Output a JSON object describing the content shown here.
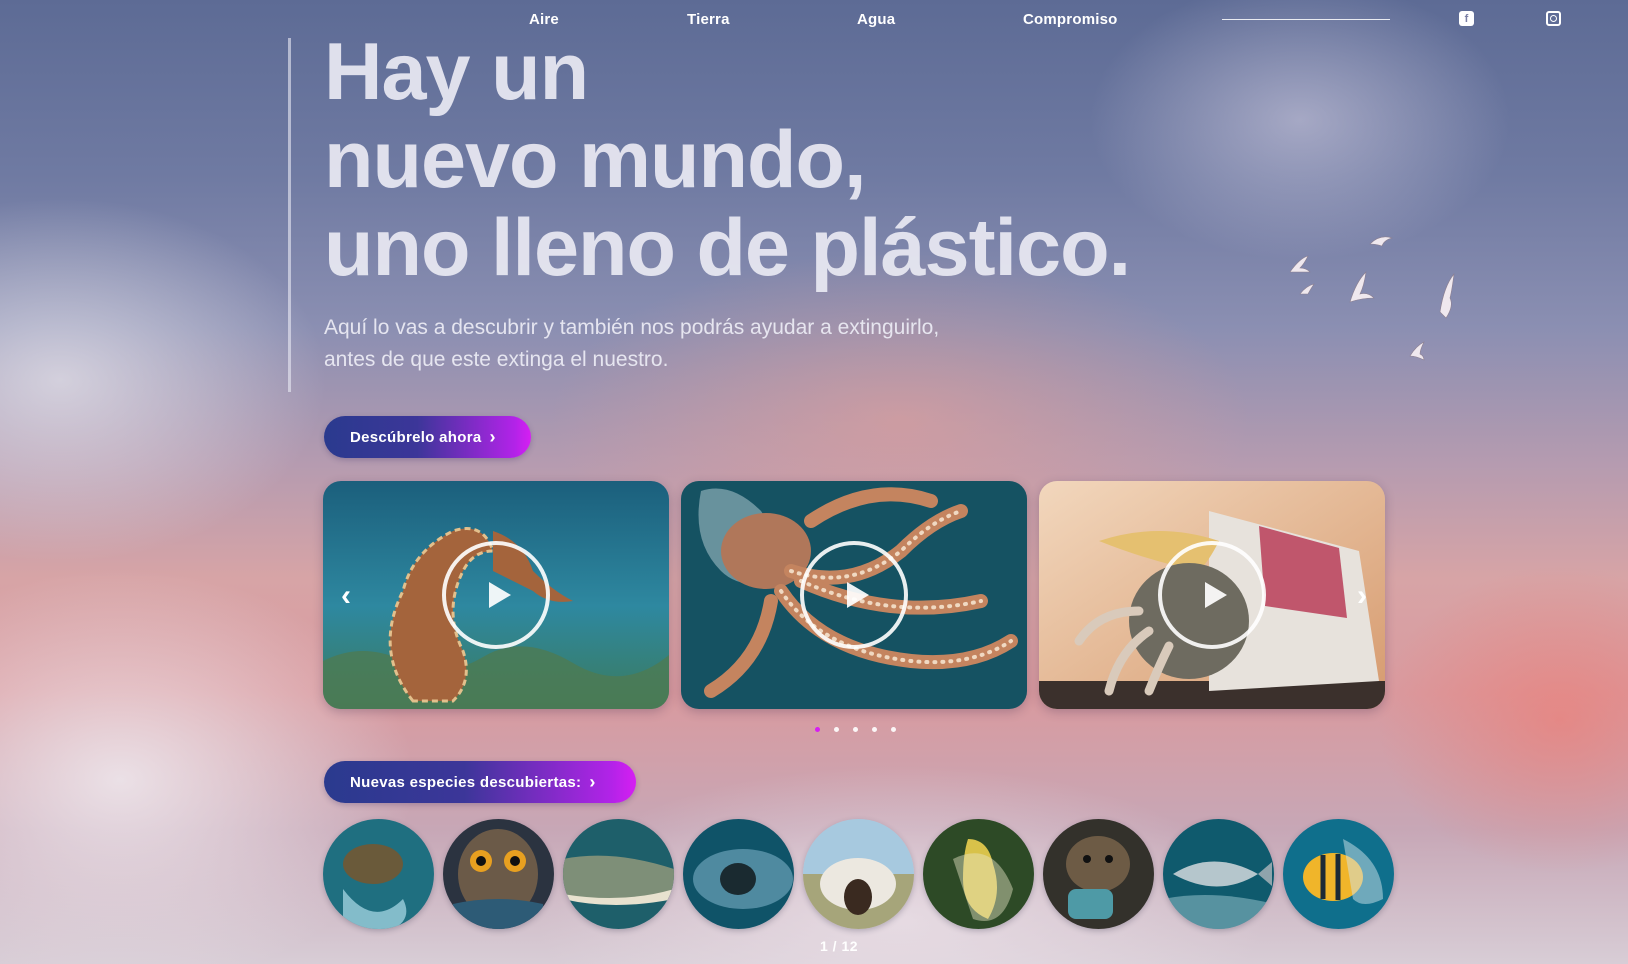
{
  "nav": {
    "links": [
      "Aire",
      "Tierra",
      "Agua",
      "Compromiso"
    ],
    "social": [
      {
        "icon": "facebook-icon",
        "glyph": "f"
      },
      {
        "icon": "instagram-icon"
      }
    ]
  },
  "hero": {
    "title_lines": [
      "Hay un",
      "nuevo mundo,",
      "uno lleno de plástico."
    ],
    "subtitle_lines": [
      "Aquí lo vas a descubrir y también nos podrás ayudar a extinguirlo,",
      "antes de que este extinga el nuestro."
    ],
    "cta_label": "Descúbrelo ahora"
  },
  "carousel": {
    "cards": [
      {
        "subject": "seahorse",
        "colors": [
          "#1d6f8a",
          "#2e8aa0",
          "#9c5a34"
        ]
      },
      {
        "subject": "octopus-in-plastic-bag",
        "colors": [
          "#15566a",
          "#1f6f80",
          "#c07a56"
        ]
      },
      {
        "subject": "hermit-crab-in-can",
        "colors": [
          "#e8b48a",
          "#f1cfae",
          "#8d2b3a"
        ]
      }
    ],
    "prev_icon": "chevron-left-icon",
    "next_icon": "chevron-right-icon",
    "dots_total": 5,
    "dots_active": 0
  },
  "species": {
    "button_label": "Nuevas especies descubiertas:",
    "items": [
      {
        "subject": "sea-turtle",
        "colors": [
          "#1f6f80",
          "#7cb9c6"
        ]
      },
      {
        "subject": "owl",
        "colors": [
          "#2b3340",
          "#7b6a55"
        ]
      },
      {
        "subject": "crocodile",
        "colors": [
          "#1e5f6a",
          "#7e8f78"
        ]
      },
      {
        "subject": "whale-shark",
        "colors": [
          "#0f5368",
          "#4f9ab0"
        ]
      },
      {
        "subject": "cow",
        "colors": [
          "#a7c9df",
          "#e8e4dc"
        ]
      },
      {
        "subject": "bird-in-plastic",
        "colors": [
          "#2d4a26",
          "#d8c24a"
        ]
      },
      {
        "subject": "otter",
        "colors": [
          "#33312b",
          "#6d5b45"
        ]
      },
      {
        "subject": "tuna",
        "colors": [
          "#0f5a6d",
          "#8fb6c2"
        ]
      },
      {
        "subject": "tropical-fish",
        "colors": [
          "#0f6f8c",
          "#f0b52a"
        ]
      }
    ],
    "pager": "1 / 12"
  },
  "chevron": "›",
  "arrows": {
    "prev": "‹",
    "next": "›"
  }
}
